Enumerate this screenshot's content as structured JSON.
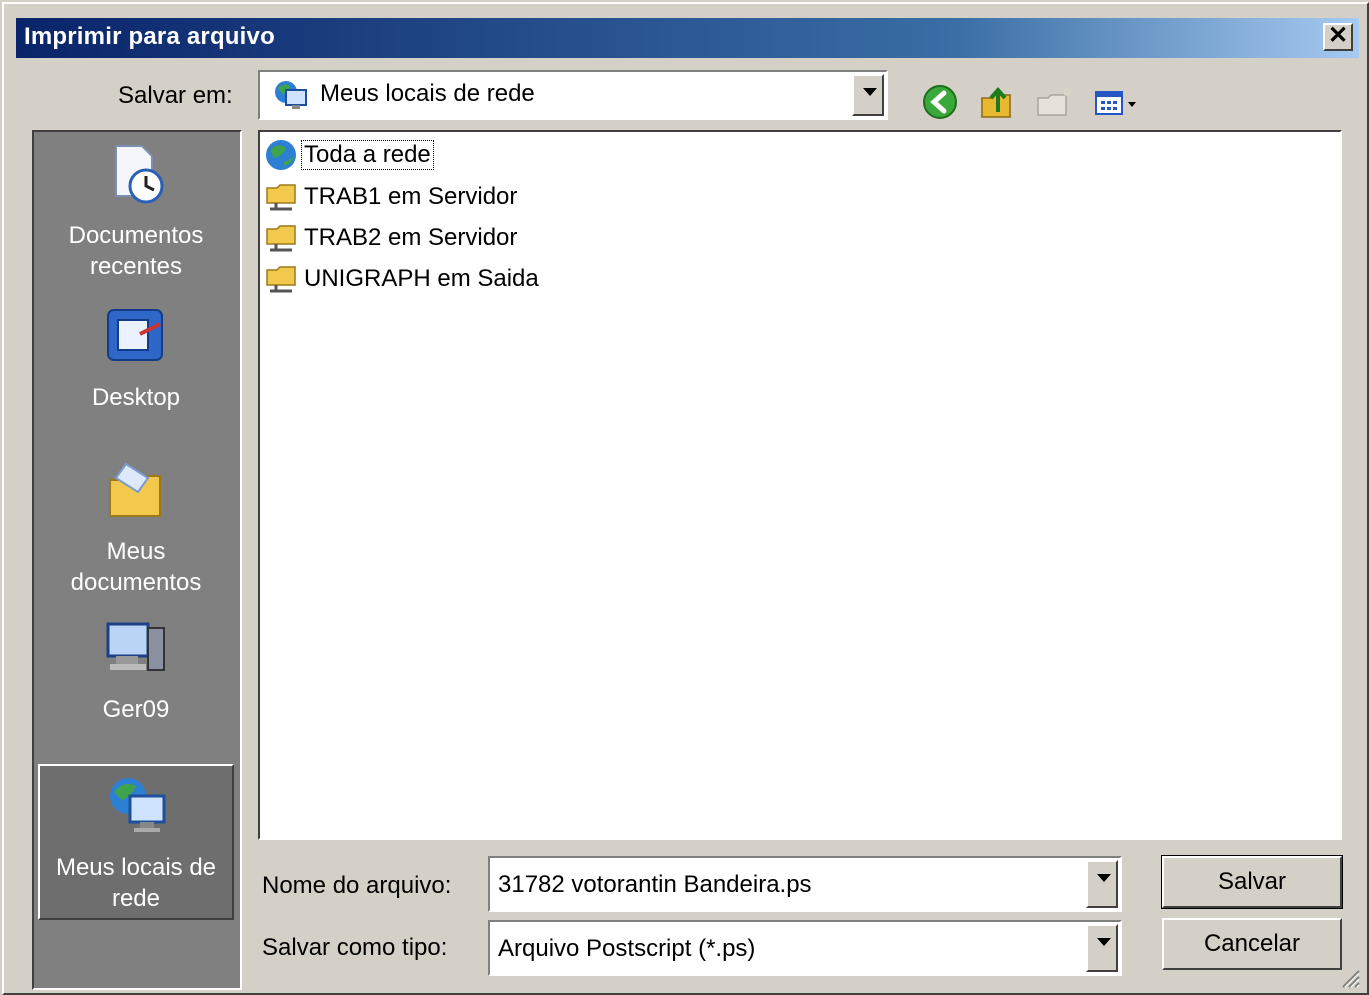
{
  "dialog": {
    "title": "Imprimir para arquivo",
    "close_glyph": "✕"
  },
  "save_in": {
    "label": "Salvar em:",
    "value": "Meus locais de rede",
    "icon": "network-places-icon"
  },
  "toolbar": {
    "icons": [
      "back-icon",
      "up-folder-icon",
      "new-folder-icon",
      "views-menu-icon"
    ]
  },
  "places_bar": [
    {
      "label_line1": "Documentos",
      "label_line2": "recentes",
      "icon": "recent-documents-icon"
    },
    {
      "label_line1": "Desktop",
      "label_line2": "",
      "icon": "desktop-icon"
    },
    {
      "label_line1": "Meus",
      "label_line2": "documentos",
      "icon": "my-documents-icon"
    },
    {
      "label_line1": "Ger09",
      "label_line2": "",
      "icon": "my-computer-icon"
    },
    {
      "label_line1": "Meus locais de",
      "label_line2": "rede",
      "icon": "network-places-icon",
      "selected": true
    }
  ],
  "file_list": [
    {
      "name": "Toda a rede",
      "icon": "globe-icon"
    },
    {
      "name": "TRAB1 em Servidor",
      "icon": "network-share-icon"
    },
    {
      "name": "TRAB2 em Servidor",
      "icon": "network-share-icon"
    },
    {
      "name": "UNIGRAPH em Saida",
      "icon": "network-share-icon"
    }
  ],
  "filename": {
    "label": "Nome do arquivo:",
    "value": "31782 votorantin Bandeira.ps"
  },
  "filetype": {
    "label": "Salvar como tipo:",
    "value": "Arquivo Postscript (*.ps)"
  },
  "buttons": {
    "save": "Salvar",
    "cancel": "Cancelar"
  },
  "colors": {
    "titlebar_start": "#0a246a",
    "titlebar_end": "#a6caf0",
    "face": "#d4d0c8",
    "places_bg": "#808080"
  }
}
